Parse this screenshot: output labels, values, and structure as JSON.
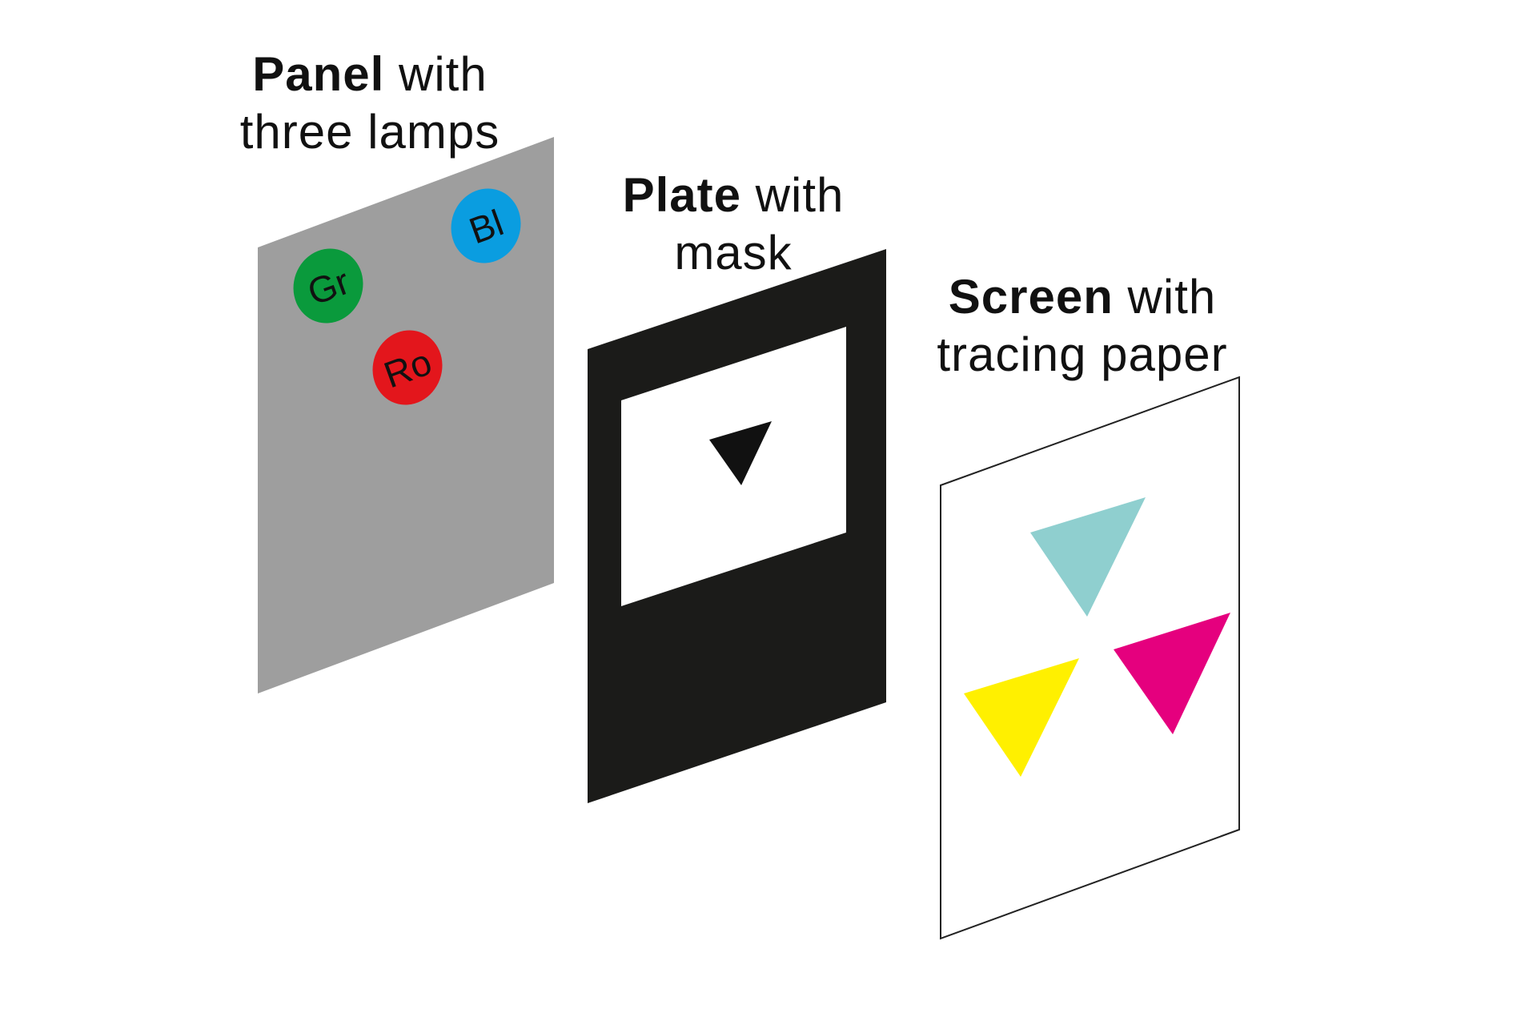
{
  "panel": {
    "title_bold": "Panel",
    "title_rest": " with",
    "title_line2": "three lamps",
    "fill": "#9e9e9e",
    "lamps": [
      {
        "label": "Gr",
        "color": "#0a9a3c"
      },
      {
        "label": "Bl",
        "color": "#0a9de0"
      },
      {
        "label": "Ro",
        "color": "#e3161c"
      }
    ]
  },
  "plate": {
    "title_bold": "Plate",
    "title_rest": " with",
    "title_line2": "mask",
    "fill": "#1b1b19",
    "window_fill": "#ffffff",
    "mask_fill": "#111111"
  },
  "screen": {
    "title_bold": "Screen",
    "title_rest": " with",
    "title_line2": "tracing paper",
    "stroke": "#222222",
    "triangles": [
      {
        "color": "#8fcfcf"
      },
      {
        "color": "#e5007e"
      },
      {
        "color": "#fff000"
      }
    ]
  }
}
